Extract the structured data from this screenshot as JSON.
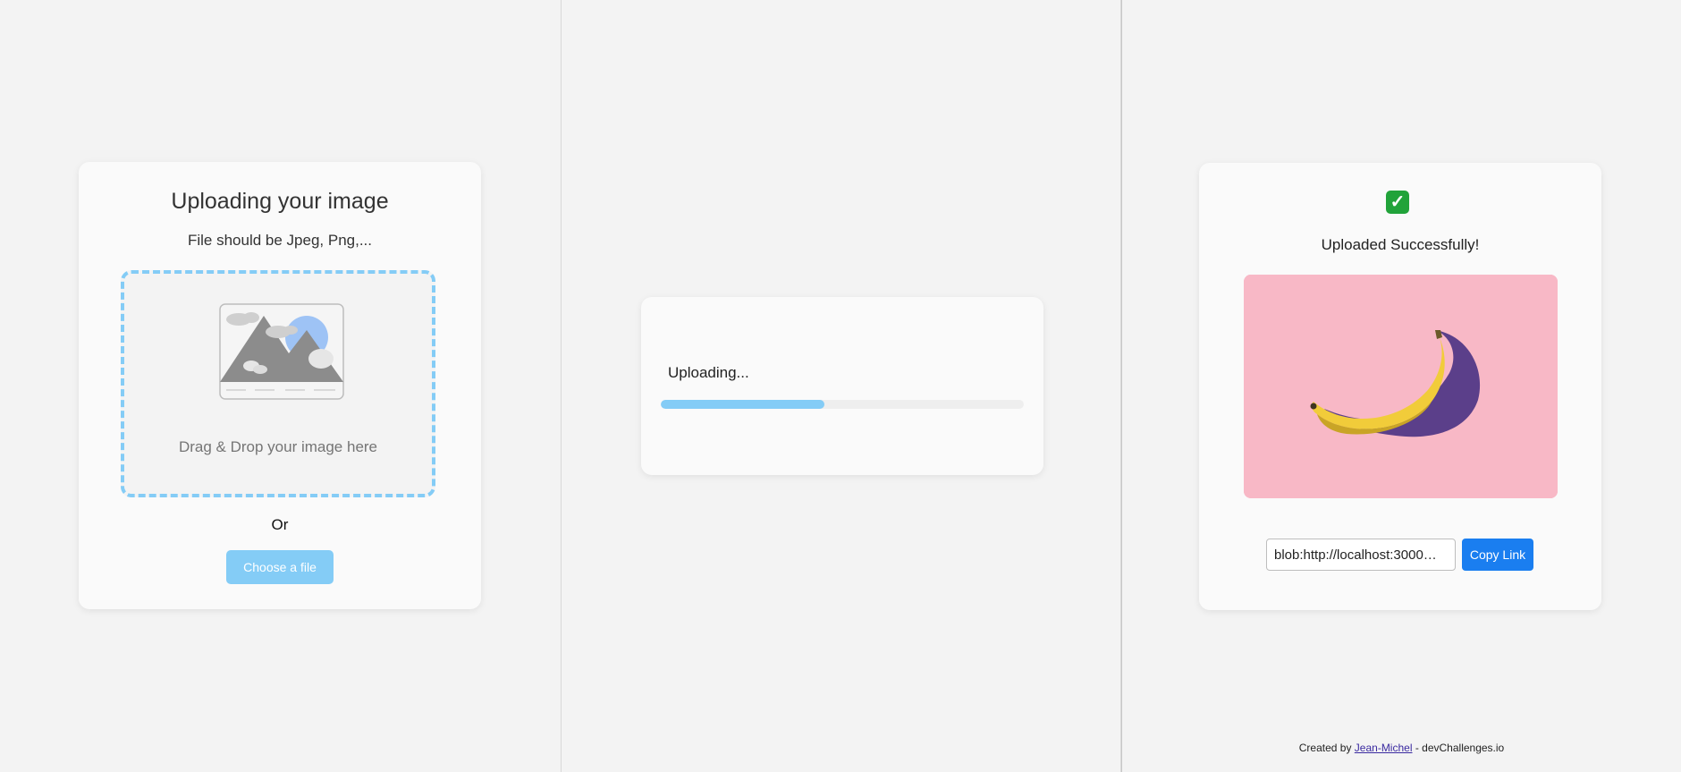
{
  "upload_card": {
    "title": "Uploading your image",
    "subtitle": "File should be Jpeg, Png,...",
    "drop_text": "Drag & Drop your image here",
    "or_text": "Or",
    "choose_button": "Choose a file"
  },
  "progress_card": {
    "status_text": "Uploading...",
    "progress_fraction": 0.45
  },
  "result_card": {
    "check_icon": "checkmark-icon",
    "success_text": "Uploaded Successfully!",
    "image": "banana-photo",
    "link_value": "blob:http://localhost:3000…",
    "copy_button": "Copy Link"
  },
  "footer": {
    "prefix": "Created by ",
    "author": "Jean-Michel",
    "suffix": " - devChallenges.io"
  },
  "colors": {
    "accent": "#84ccf6",
    "button_blue": "#1a7ef0",
    "image_background": "#f8b8c6",
    "success_green": "#21a33a"
  }
}
